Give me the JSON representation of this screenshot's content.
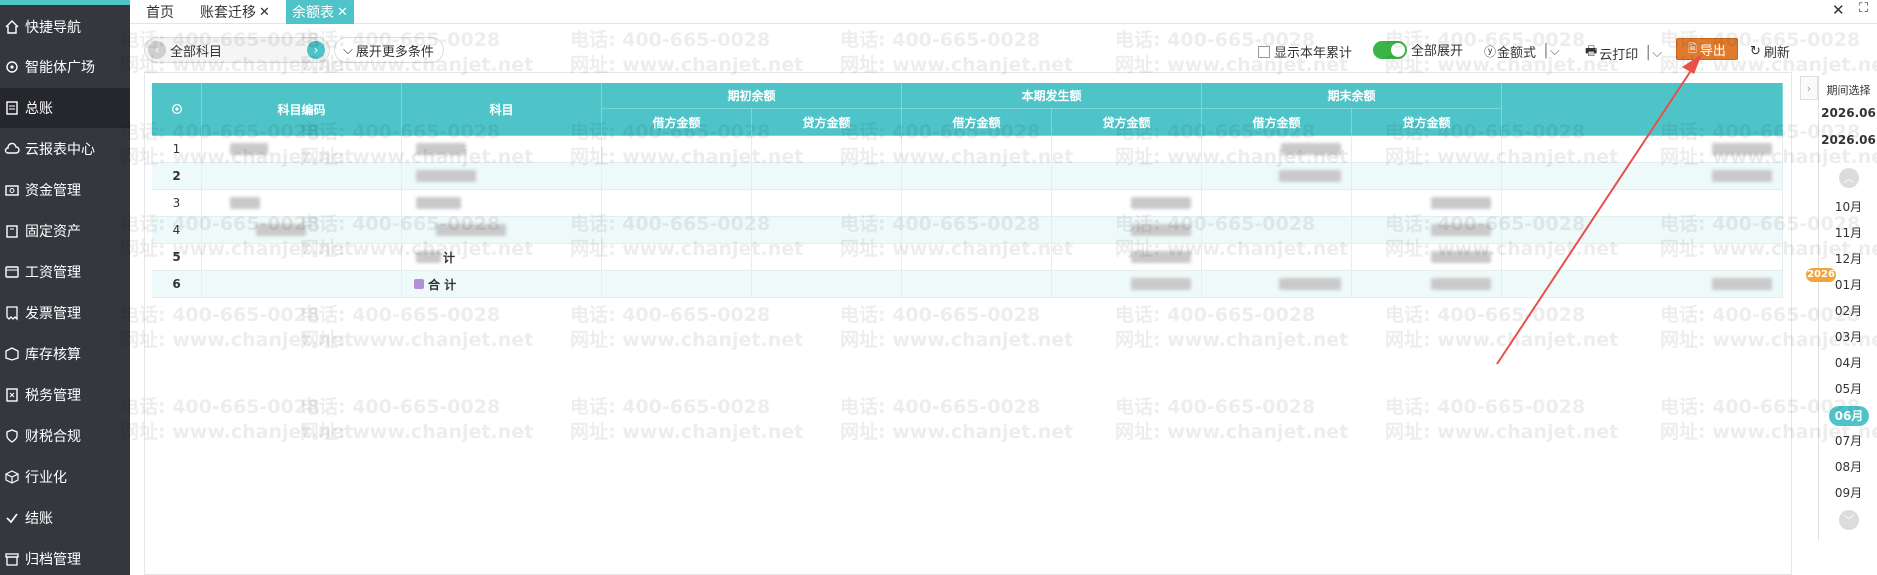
{
  "sidebar": {
    "items": [
      {
        "label": "快捷导航",
        "icon": "home-icon"
      },
      {
        "label": "智能体广场",
        "icon": "gear-icon"
      },
      {
        "label": "总账",
        "icon": "ledger-icon"
      },
      {
        "label": "云报表中心",
        "icon": "cloud-icon"
      },
      {
        "label": "资金管理",
        "icon": "money-icon"
      },
      {
        "label": "固定资产",
        "icon": "asset-icon"
      },
      {
        "label": "工资管理",
        "icon": "salary-icon"
      },
      {
        "label": "发票管理",
        "icon": "invoice-icon"
      },
      {
        "label": "库存核算",
        "icon": "inventory-icon"
      },
      {
        "label": "税务管理",
        "icon": "tax-icon"
      },
      {
        "label": "财税合规",
        "icon": "compliance-icon"
      },
      {
        "label": "行业化",
        "icon": "cube-icon"
      },
      {
        "label": "结账",
        "icon": "checkout-icon"
      },
      {
        "label": "归档管理",
        "icon": "archive-icon"
      }
    ]
  },
  "tabs": [
    {
      "label": "首页",
      "closable": false
    },
    {
      "label": "账套迁移",
      "closable": true
    },
    {
      "label": "余额表",
      "closable": true
    }
  ],
  "toolbar": {
    "subject_value": "全部科目",
    "expand_more_label": "展开更多条件",
    "show_ytd_label": "显示本年累计",
    "expand_all_label": "全部展开",
    "amount_format_label": "金额式",
    "cloud_print_label": "云打印",
    "export_label": "导出",
    "refresh_label": "刷新"
  },
  "table": {
    "headers": {
      "code": "科目编码",
      "subject": "科目",
      "opening": "期初余额",
      "current": "本期发生额",
      "closing": "期末余额",
      "debit": "借方金额",
      "credit": "贷方金额"
    },
    "rows": [
      {
        "no": "1",
        "bold": false,
        "subject": ""
      },
      {
        "no": "2",
        "bold": true,
        "subject": ""
      },
      {
        "no": "3",
        "bold": false,
        "subject": ""
      },
      {
        "no": "4",
        "bold": false,
        "subject": ""
      },
      {
        "no": "5",
        "bold": true,
        "subject": "计"
      },
      {
        "no": "6",
        "bold": true,
        "subject": "合 计"
      }
    ]
  },
  "period_panel": {
    "title": "期间选择",
    "start": "2026.06",
    "end": "2026.06",
    "year_badge": "2026",
    "months": [
      "10月",
      "11月",
      "12月",
      "01月",
      "02月",
      "03月",
      "04月",
      "05月",
      "06月",
      "07月",
      "08月",
      "09月"
    ],
    "selected_month": "06月"
  },
  "watermark": {
    "phone": "电话: 400-665-0028",
    "site": "网址: www.chanjet.net"
  },
  "colors": {
    "sidebar_bg": "#34373e",
    "accent": "#4ec4c9",
    "export_orange": "#e07b2e",
    "annotation_red": "#e8504a"
  }
}
